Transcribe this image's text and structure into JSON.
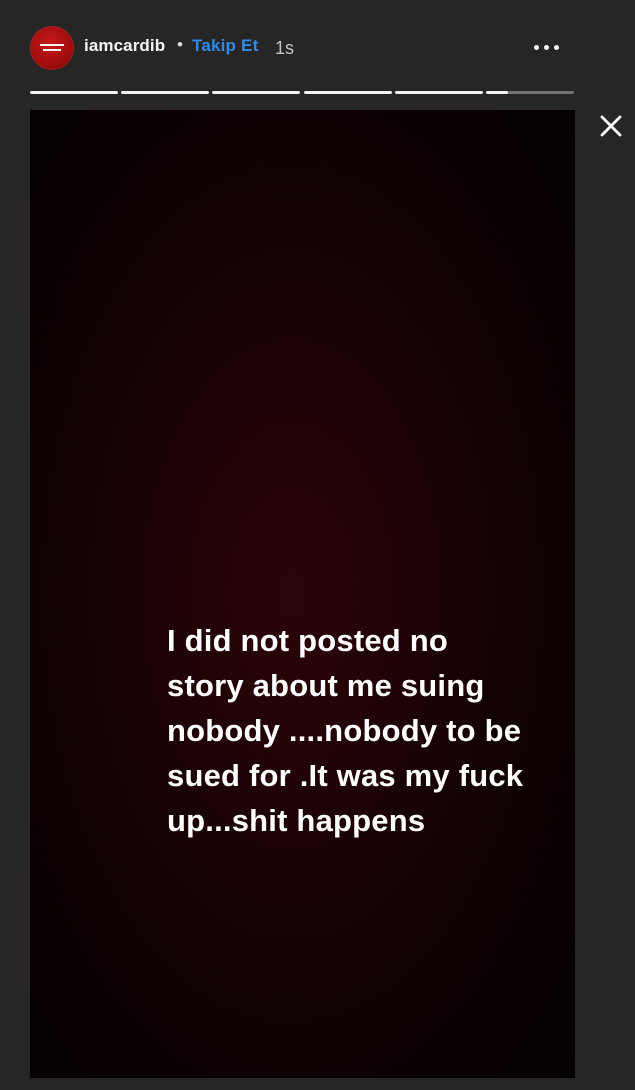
{
  "header": {
    "avatar_text": "BREONNA TAYLOR",
    "username": "iamcardib",
    "separator": "•",
    "follow_label": "Takip Et",
    "time_ago": "1s"
  },
  "story": {
    "progress": [
      {
        "fill": 1
      },
      {
        "fill": 1
      },
      {
        "fill": 1
      },
      {
        "fill": 1
      },
      {
        "fill": 1
      },
      {
        "fill": 0.25
      }
    ],
    "text": "I did not posted no story about me suing nobody ....nobody to be sued for .It was my fuck up...shit happens"
  },
  "icons": {
    "more": "more-options-icon",
    "close": "close-icon"
  },
  "colors": {
    "background": "#262626",
    "accent": "#2f8be8",
    "avatar_red": "#c81a1a"
  }
}
